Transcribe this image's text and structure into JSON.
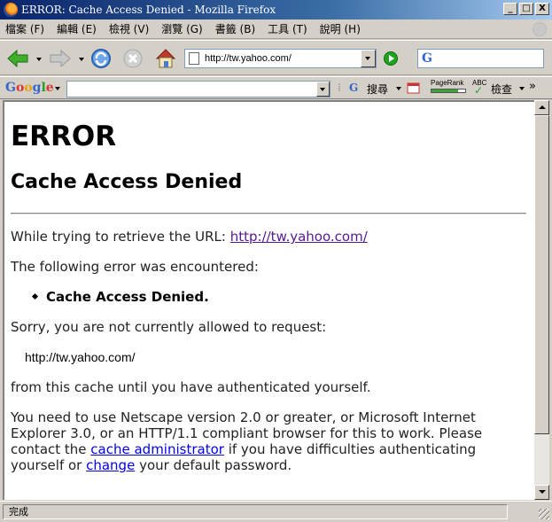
{
  "window": {
    "title": "ERROR: Cache Access Denied - Mozilla Firefox",
    "controls": [
      "_",
      "□",
      "X"
    ]
  },
  "menu": {
    "items": [
      "檔案 (F)",
      "編輯 (E)",
      "檢視 (V)",
      "瀏覽 (G)",
      "書籤 (B)",
      "工具 (T)",
      "說明 (H)"
    ]
  },
  "nav": {
    "url": "http://tw.yahoo.com/",
    "search_engine_letter": "G"
  },
  "google_toolbar": {
    "logo": "Google",
    "search_label": "搜尋",
    "pagerank_label": "PageRank",
    "pagerank_fraction": 0.8,
    "spell_label": "ABC",
    "check_label": "檢查",
    "more": "»"
  },
  "page": {
    "h1": "ERROR",
    "h2": "Cache Access Denied",
    "p1_prefix": "While trying to retrieve the URL: ",
    "p1_link": "http://tw.yahoo.com/",
    "p2": "The following error was encountered:",
    "bullet": "Cache Access Denied.",
    "p3": "Sorry, you are not currently allowed to request:",
    "requested_url": "http://tw.yahoo.com/",
    "p4": "from this cache until you have authenticated yourself.",
    "p5_part1": "You need to use Netscape version 2.0 or greater, or Microsoft Internet Explorer 3.0, or an HTTP/1.1 compliant browser for this to work. Please contact the ",
    "p5_link1": "cache administrator",
    "p5_part2": " if you have difficulties authenticating yourself or ",
    "p5_link2": "change",
    "p5_part3": " your default password."
  },
  "status": {
    "text": "完成"
  },
  "colors": {
    "title_bar": "#0a246a",
    "chrome": "#d4d0c8",
    "link_visited": "#551a8b",
    "link": "#0000ee"
  }
}
